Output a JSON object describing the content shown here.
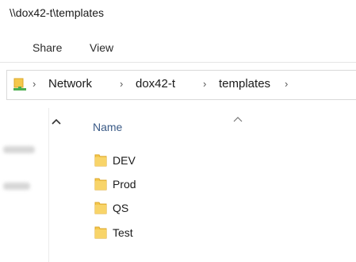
{
  "window": {
    "title": "\\\\dox42-t\\templates"
  },
  "ribbon": {
    "tabs": [
      "Share",
      "View"
    ]
  },
  "address_bar": {
    "crumbs": [
      "Network",
      "dox42-t",
      "templates"
    ]
  },
  "list": {
    "column_header": "Name",
    "items": [
      {
        "name": "DEV"
      },
      {
        "name": "Prod"
      },
      {
        "name": "QS"
      },
      {
        "name": "Test"
      }
    ]
  },
  "colors": {
    "folder": "#f5c84c",
    "folder_dark": "#dca72a",
    "header_text": "#3a5a86",
    "address_icon_green": "#4caf50"
  }
}
